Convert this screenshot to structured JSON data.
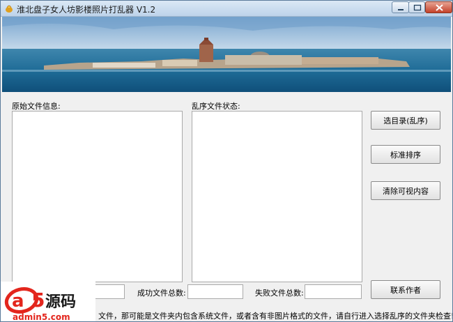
{
  "window": {
    "title": "淮北盘子女人坊影楼照片打乱器 V1.2",
    "controls": {
      "minimize": "minimize",
      "maximize": "maximize",
      "close": "close"
    }
  },
  "banner": {
    "image": "venice-lagoon-photo",
    "description_icon": "banner-image"
  },
  "left_panel": {
    "label": "原始文件信息:"
  },
  "right_panel": {
    "label": "乱序文件状态:"
  },
  "buttons": {
    "select_dir": "选目录(乱序)",
    "standard_sort": "标准排序",
    "clear_view": "清除可视内容",
    "contact_author": "联系作者"
  },
  "counters": {
    "success_label": "成功文件总数:",
    "success_value": "",
    "fail_label": "失败文件总数:",
    "fail_value": "",
    "total_value": ""
  },
  "status_text": "文件，那可能是文件夹内包含系统文件，或者含有非图片格式的文件，请自行进入选择乱序的文件夹检查!",
  "watermark": {
    "brand": "a5源码",
    "site": "admin5.com",
    "color_accent": "#e3261d"
  },
  "colors": {
    "titlebar": "#bdd3ea",
    "close": "#c4412a",
    "window_bg": "#f0f0f0"
  }
}
